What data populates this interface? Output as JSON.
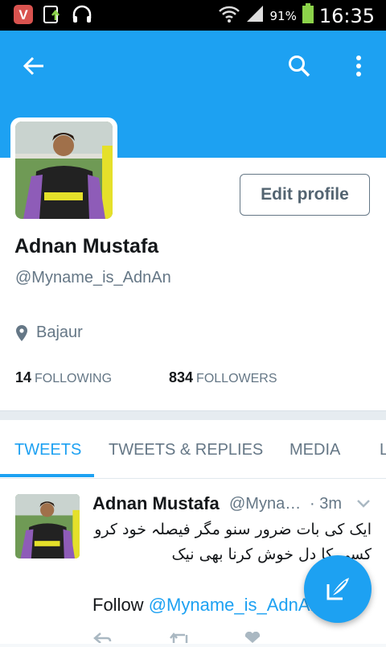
{
  "status_bar": {
    "battery_pct": "91%",
    "time": "16:35"
  },
  "app_bar": {
    "back_icon": "arrow-left-icon",
    "search_icon": "search-icon",
    "menu_icon": "more-vert-icon"
  },
  "profile": {
    "edit_label": "Edit profile",
    "name": "Adnan Mustafa",
    "handle": "@Myname_is_AdnAn",
    "location": "Bajaur",
    "following_count": "14",
    "following_label": "FOLLOWING",
    "followers_count": "834",
    "followers_label": "FOLLOWERS"
  },
  "tabs": [
    {
      "label": "TWEETS"
    },
    {
      "label": "TWEETS & REPLIES"
    },
    {
      "label": "MEDIA"
    },
    {
      "label": "L"
    }
  ],
  "tweet": {
    "name": "Adnan Mustafa",
    "handle": "@Myna…",
    "time": "· 3m",
    "line1": "ایک کی بات ضرور سنو مگر فیصلہ خود کرو",
    "line2": "کسی کا دل خوش کرنا بھی نیک",
    "follow_prefix": "Follow",
    "follow_link": "@Myname_is_AdnAn"
  },
  "colors": {
    "accent": "#1da1f2",
    "text": "#14171a",
    "muted": "#657786"
  }
}
